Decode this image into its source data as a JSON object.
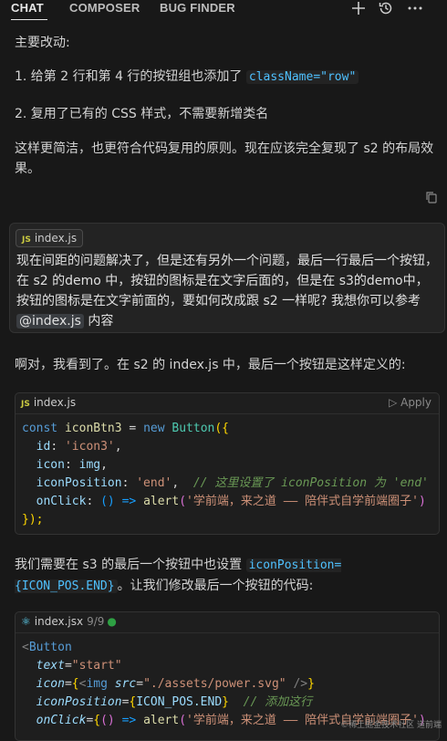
{
  "tabs": [
    "CHAT",
    "COMPOSER",
    "BUG FINDER"
  ],
  "toolbar": {
    "new_icon": "plus-icon",
    "history_icon": "history-icon",
    "more_icon": "more-icon"
  },
  "msg1": {
    "heading": "主要改动:",
    "item1_prefix": "1. 给第 2 行和第 4 行的按钮组也添加了 ",
    "item1_code": "className=\"row\"",
    "item2": "2. 复用了已有的 CSS 样式，不需要新增类名",
    "para": "这样更简洁，也更符合代码复用的原则。现在应该完全复现了 s2 的布局效果。"
  },
  "user": {
    "file_badge": "JS",
    "file_name": "index.js",
    "text_prefix": "现在间距的问题解决了，但是还有另外一个问题，最后一行最后一个按钮，在 s2 的demo 中，按钮的图标是在文字后面的，但是在 s3的demo中，按钮的图标是在文字前面的，要如何改成跟 s2 一样呢? 我想你可以参考 ",
    "mention": "@index.js",
    "text_suffix": " 内容"
  },
  "msg2": {
    "para": "啊对，我看到了。在 s2 的 index.js 中，最后一个按钮是这样定义的:",
    "block1": {
      "badge": "JS",
      "file": "index.js",
      "apply": "Apply",
      "l1_kw": "const",
      "l1_var": "iconBtn3",
      "l1_eq": " = ",
      "l1_new": "new",
      "l1_cls": "Button",
      "l1_open": "({",
      "l2_key": "id",
      "l2_val": "'icon3'",
      "l3_key": "icon",
      "l3_val": "img",
      "l4_key": "iconPosition",
      "l4_val": "'end'",
      "l4_cm": "// 这里设置了 iconPosition 为 'end'",
      "l5_key": "onClick",
      "l5_arrow": "() =>",
      "l5_fn": "alert",
      "l5_str": "'学前端，来之道 —— 陪伴式自学前端圈子'",
      "l6": "});"
    },
    "para2_prefix": "我们需要在 s3 的最后一个按钮中也设置 ",
    "para2_code": "iconPosition={ICON_POS.END}",
    "para2_suffix": "。让我们修改最后一个按钮的代码:",
    "block2": {
      "file": "index.jsx",
      "count": "9/9",
      "dot": "●",
      "l1": "Button",
      "l2_attr": "text",
      "l2_val": "\"start\"",
      "l3_attr": "icon",
      "l3_tag": "img",
      "l3_src_attr": "src",
      "l3_src": "\"./assets/power.svg\"",
      "l4_attr": "iconPosition",
      "l4_val": "ICON_POS.END",
      "l4_cm": "// 添加这行",
      "l5_attr": "onClick",
      "l5_fn": "alert",
      "l5_str": "'学前端，来之道 —— 陪伴式自学前端圈子'"
    }
  },
  "watermark": "©稀土掘金技术社区 道前端"
}
